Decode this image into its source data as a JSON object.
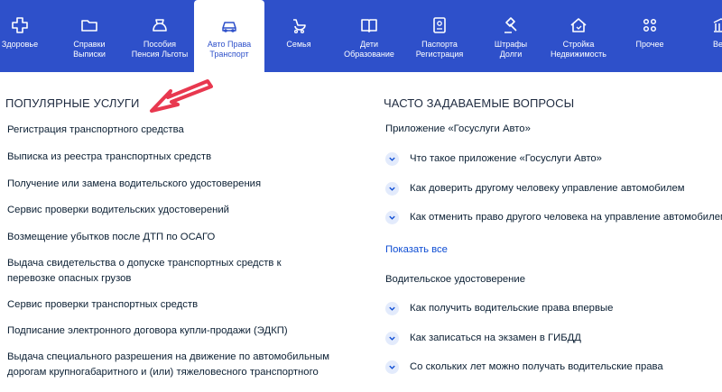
{
  "categories": [
    {
      "label": "Здоровье",
      "icon": "plus-icon"
    },
    {
      "label": "Справки\nВыписки",
      "icon": "folder-icon"
    },
    {
      "label": "Пособия\nПенсия Льготы",
      "icon": "wallet-icon"
    },
    {
      "label": "Авто Права\nТранспорт",
      "icon": "car-icon",
      "active": true
    },
    {
      "label": "Семья",
      "icon": "stroller-icon"
    },
    {
      "label": "Дети\nОбразование",
      "icon": "book-icon"
    },
    {
      "label": "Паспорта\nРегистрация",
      "icon": "passport-icon"
    },
    {
      "label": "Штрафы\nДолги",
      "icon": "gavel-icon"
    },
    {
      "label": "Стройка\nНедвижимость",
      "icon": "house-icon"
    },
    {
      "label": "Прочее",
      "icon": "grid-icon"
    },
    {
      "label": "Ведом",
      "icon": "building-icon"
    }
  ],
  "popular": {
    "title": "ПОПУЛЯРНЫЕ УСЛУГИ",
    "items": [
      "Регистрация транспортного средства",
      "Выписка из реестра транспортных средств",
      "Получение или замена водительского удостоверения",
      "Сервис проверки водительских удостоверений",
      "Возмещение убытков после ДТП по ОСАГО",
      "Выдача свидетельства о допуске транспортных средств к перевозке опасных грузов",
      "Сервис проверки транспортных средств",
      "Подписание электронного договора купли-продажи (ЭДКП)",
      "Выдача специального разрешения на движение по автомобильным дорогам крупногабаритного и (или) тяжеловесного транспортного"
    ]
  },
  "faq": {
    "title": "ЧАСТО ЗАДАВАЕМЫЕ ВОПРОСЫ",
    "group1": {
      "title": "Приложение «Госуслуги Авто»",
      "questions": [
        "Что такое приложение «Госуслуги Авто»",
        "Как доверить другому человеку управление автомобилем",
        "Как отменить право другого человека на управление автомобилем"
      ]
    },
    "show_all": "Показать все",
    "group2": {
      "title": "Водительское удостоверение",
      "questions": [
        "Как получить водительские права впервые",
        "Как записаться на экзамен в ГИБДД",
        "Со скольких лет можно получать водительские права"
      ]
    }
  },
  "colors": {
    "topbar": "#2e50ca",
    "link": "#0d4cd3",
    "arrow": "#e8384f",
    "chevron_bg": "#e3ebfc"
  }
}
